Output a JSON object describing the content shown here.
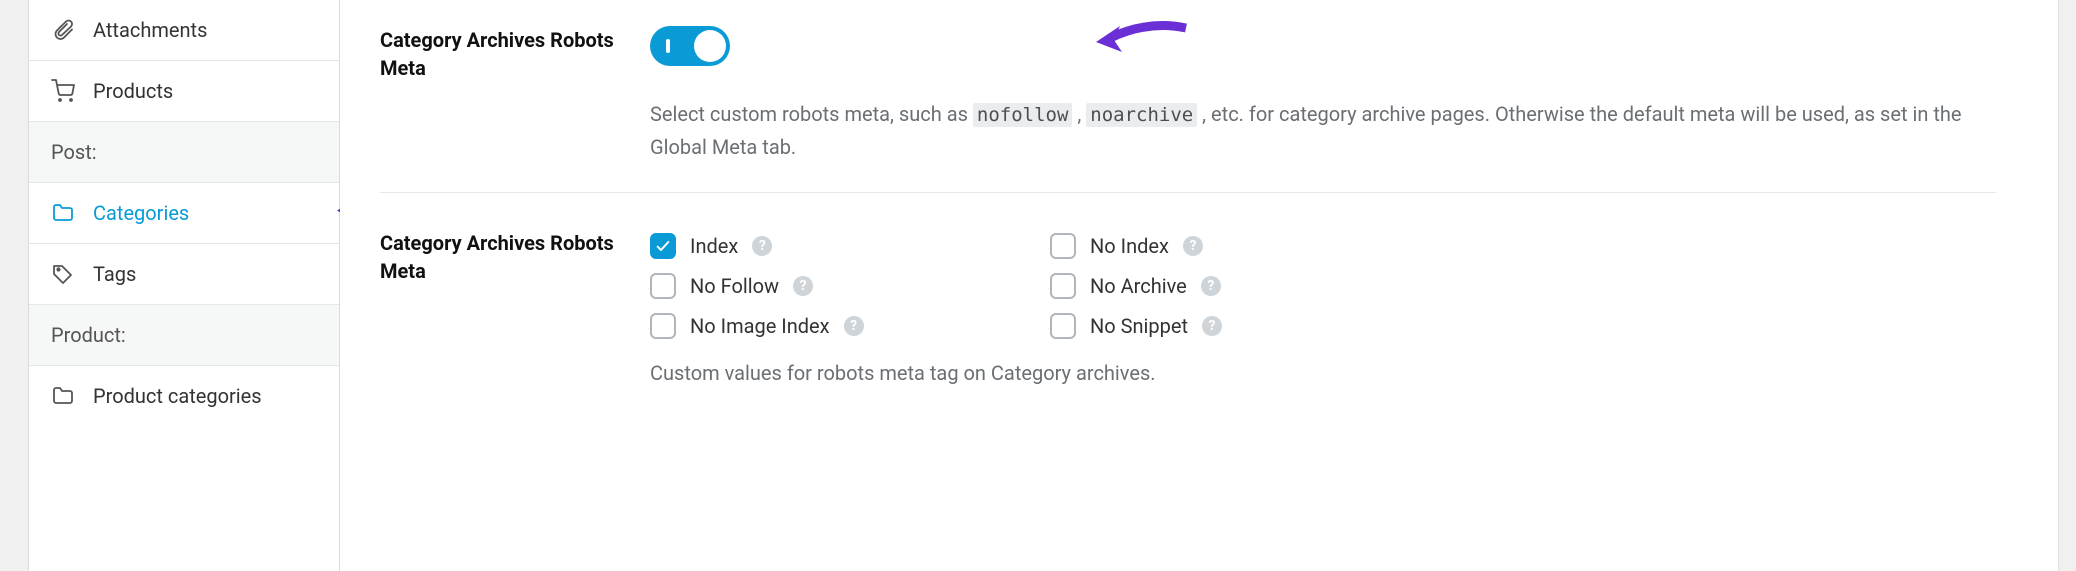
{
  "sidebar": {
    "items": [
      {
        "label": "Attachments",
        "icon": "paperclip"
      },
      {
        "label": "Products",
        "icon": "cart"
      }
    ],
    "group1_label": "Post:",
    "post_items": [
      {
        "label": "Categories",
        "icon": "folder",
        "active": true
      },
      {
        "label": "Tags",
        "icon": "tag"
      }
    ],
    "group2_label": "Product:",
    "product_items": [
      {
        "label": "Product categories",
        "icon": "folder"
      }
    ]
  },
  "section1": {
    "title": "Category Archives Robots Meta",
    "desc_pre": "Select custom robots meta, such as ",
    "code1": "nofollow",
    "sep": " , ",
    "code2": "noarchive",
    "desc_post": " , etc. for category archive pages. Otherwise the default meta will be used, as set in the Global Meta tab."
  },
  "section2": {
    "title": "Category Archives Robots Meta",
    "options": [
      {
        "label": "Index",
        "checked": true
      },
      {
        "label": "No Index",
        "checked": false
      },
      {
        "label": "No Follow",
        "checked": false
      },
      {
        "label": "No Archive",
        "checked": false
      },
      {
        "label": "No Image Index",
        "checked": false
      },
      {
        "label": "No Snippet",
        "checked": false
      }
    ],
    "hint": "Custom values for robots meta tag on Category archives."
  }
}
